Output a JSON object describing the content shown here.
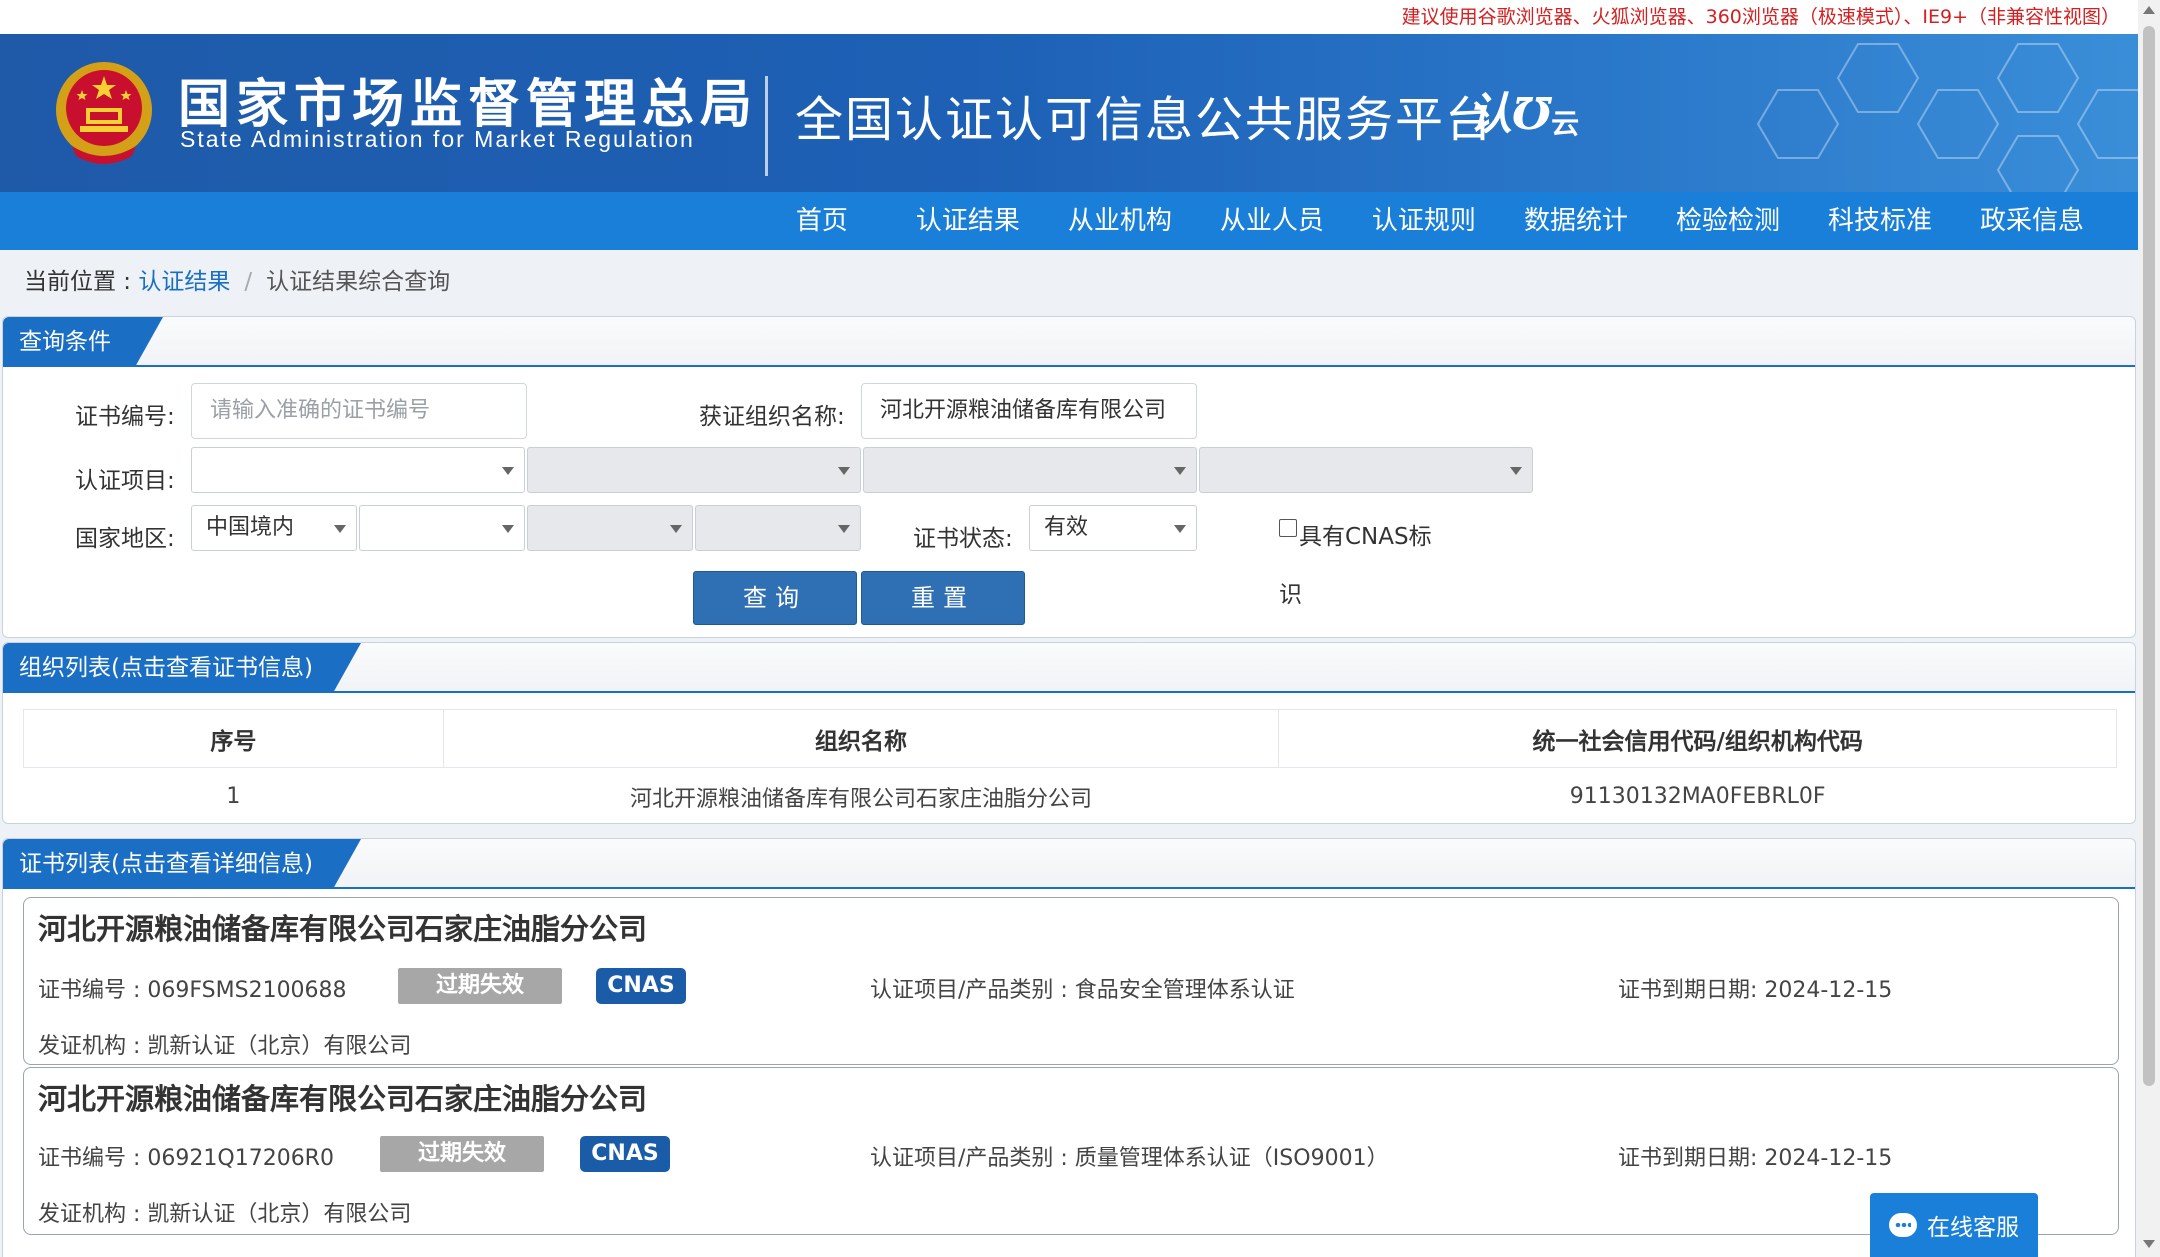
{
  "notice": "建议使用谷歌浏览器、火狐浏览器、360浏览器（极速模式）、IE9+（非兼容性视图）",
  "header": {
    "agency_cn": "国家市场监督管理总局",
    "agency_en": "State Administration  for  Market Regulation",
    "platform_title": "全国认证认可信息公共服务平台",
    "platform_logo_main": "认",
    "platform_logo_sub": "云"
  },
  "nav": {
    "items": [
      "首页",
      "认证结果",
      "从业机构",
      "从业人员",
      "认证规则",
      "数据统计",
      "检验检测",
      "科技标准",
      "政采信息"
    ]
  },
  "breadcrumb": {
    "prefix": "当前位置 : ",
    "parent": "认证结果",
    "separator": "/",
    "current": "认证结果综合查询"
  },
  "query": {
    "section_title": "查询条件",
    "cert_no_label": "证书编号:",
    "cert_no_placeholder": "请输入准确的证书编号",
    "org_name_label": "获证组织名称:",
    "org_name_value": "河北开源粮油储备库有限公司",
    "project_label": "认证项目:",
    "region_label": "国家地区:",
    "region_value": "中国境内",
    "status_label": "证书状态:",
    "status_value": "有效",
    "cnas_label_line1": "具有CNAS标",
    "cnas_label_line2": "识",
    "search_button": "查询",
    "reset_button": "重置"
  },
  "org_list": {
    "section_title": "组织列表(点击查看证书信息)",
    "columns": [
      "序号",
      "组织名称",
      "统一社会信用代码/组织机构代码"
    ],
    "rows": [
      {
        "index": "1",
        "name": "河北开源粮油储备库有限公司石家庄油脂分公司",
        "code": "91130132MA0FEBRL0F"
      }
    ]
  },
  "cert_list": {
    "section_title": "证书列表(点击查看详细信息)",
    "items": [
      {
        "org": "河北开源粮油储备库有限公司石家庄油脂分公司",
        "cert_no": "证书编号 : 069FSMS2100688",
        "status_badge": "过期失效",
        "cnas_badge": "CNAS",
        "project": "认证项目/产品类别 : 食品安全管理体系认证",
        "expiry": "证书到期日期: 2024-12-15",
        "issuer": "发证机构 : 凯新认证（北京）有限公司"
      },
      {
        "org": "河北开源粮油储备库有限公司石家庄油脂分公司",
        "cert_no": "证书编号 : 06921Q17206R0",
        "status_badge": "过期失效",
        "cnas_badge": "CNAS",
        "project": "认证项目/产品类别 : 质量管理体系认证（ISO9001）",
        "expiry": "证书到期日期: 2024-12-15",
        "issuer": "发证机构 : 凯新认证（北京）有限公司"
      }
    ]
  },
  "chat": {
    "label": "在线客服",
    "icon": "chat-bubble-icon"
  },
  "colors": {
    "header_blue": "#1f5aa9",
    "nav_blue": "#1a7fd9",
    "section_blue": "#1a6fc5",
    "notice_red": "#d42020",
    "expired_gray": "#a7a7a7",
    "cnas_blue": "#1a5ca8"
  }
}
